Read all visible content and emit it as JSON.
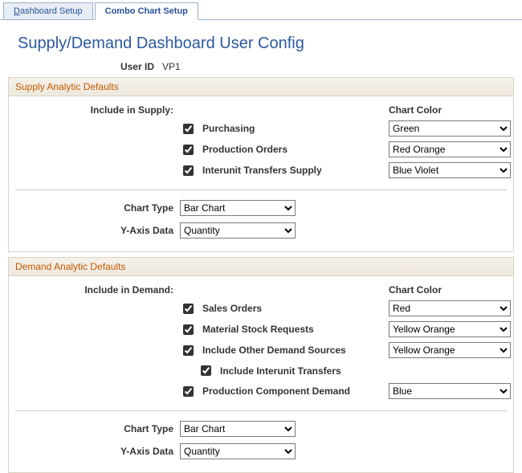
{
  "tabs": {
    "dashboard_setup_prefix": "D",
    "dashboard_setup_rest": "ashboard Setup",
    "combo_chart": "Combo Chart Setup"
  },
  "page_title": "Supply/Demand Dashboard User Config",
  "user_id_label": "User ID",
  "user_id_value": "VP1",
  "supply": {
    "section_title": "Supply Analytic Defaults",
    "include_label": "Include in Supply:",
    "chart_color_label": "Chart Color",
    "items": [
      {
        "label": "Purchasing",
        "color": "Green"
      },
      {
        "label": "Production Orders",
        "color": "Red Orange"
      },
      {
        "label": "Interunit Transfers Supply",
        "color": "Blue Violet"
      }
    ],
    "chart_type_label": "Chart Type",
    "chart_type_value": "Bar Chart",
    "y_axis_label": "Y-Axis Data",
    "y_axis_value": "Quantity"
  },
  "demand": {
    "section_title": "Demand Analytic Defaults",
    "include_label": "Include in Demand:",
    "chart_color_label": "Chart Color",
    "items": [
      {
        "label": "Sales Orders",
        "color": "Red"
      },
      {
        "label": "Material Stock Requests",
        "color": "Yellow Orange"
      },
      {
        "label": "Include Other Demand Sources",
        "color": "Yellow Orange"
      },
      {
        "label": "Include Interunit Transfers",
        "indent": true
      },
      {
        "label": "Production Component Demand",
        "color": "Blue"
      }
    ],
    "chart_type_label": "Chart Type",
    "chart_type_value": "Bar Chart",
    "y_axis_label": "Y-Axis Data",
    "y_axis_value": "Quantity"
  }
}
